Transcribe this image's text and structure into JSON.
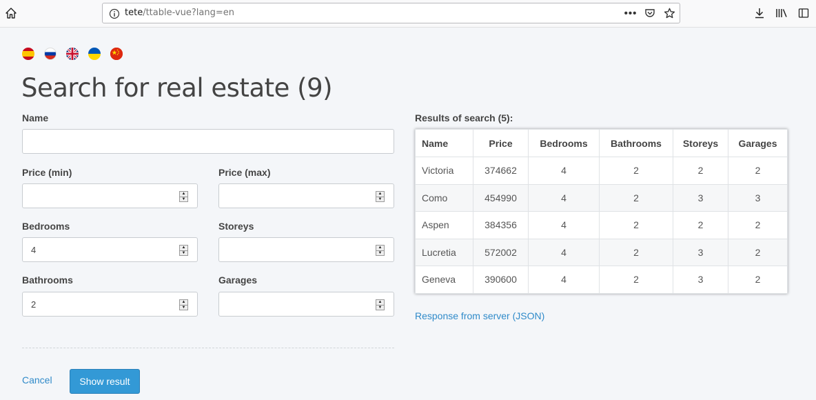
{
  "browser": {
    "url_host": "tete",
    "url_path": "/ttable-vue?lang=en",
    "page_actions_dots": "•••"
  },
  "languages": [
    {
      "code": "es",
      "icon": "spain-flag-icon"
    },
    {
      "code": "ru",
      "icon": "russia-flag-icon"
    },
    {
      "code": "en",
      "icon": "uk-flag-icon"
    },
    {
      "code": "ua",
      "icon": "ukraine-flag-icon"
    },
    {
      "code": "cn",
      "icon": "china-flag-icon"
    }
  ],
  "title": "Search for real estate (9)",
  "form": {
    "name": {
      "label": "Name",
      "value": ""
    },
    "price_min": {
      "label": "Price (min)",
      "value": ""
    },
    "price_max": {
      "label": "Price (max)",
      "value": ""
    },
    "bedrooms": {
      "label": "Bedrooms",
      "value": "4"
    },
    "storeys": {
      "label": "Storeys",
      "value": ""
    },
    "bathrooms": {
      "label": "Bathrooms",
      "value": "2"
    },
    "garages": {
      "label": "Garages",
      "value": ""
    },
    "cancel_label": "Cancel",
    "submit_label": "Show result"
  },
  "results": {
    "label": "Results of search (5):",
    "columns": [
      "Name",
      "Price",
      "Bedrooms",
      "Bathrooms",
      "Storeys",
      "Garages"
    ],
    "rows": [
      [
        "Victoria",
        "374662",
        "4",
        "2",
        "2",
        "2"
      ],
      [
        "Como",
        "454990",
        "4",
        "2",
        "3",
        "3"
      ],
      [
        "Aspen",
        "384356",
        "4",
        "2",
        "2",
        "2"
      ],
      [
        "Lucretia",
        "572002",
        "4",
        "2",
        "3",
        "2"
      ],
      [
        "Geneva",
        "390600",
        "4",
        "2",
        "3",
        "2"
      ]
    ],
    "json_link": "Response from server (JSON)"
  },
  "colors": {
    "accent": "#3399d6",
    "link": "#2f8ac9",
    "background": "#f4f6f9"
  }
}
